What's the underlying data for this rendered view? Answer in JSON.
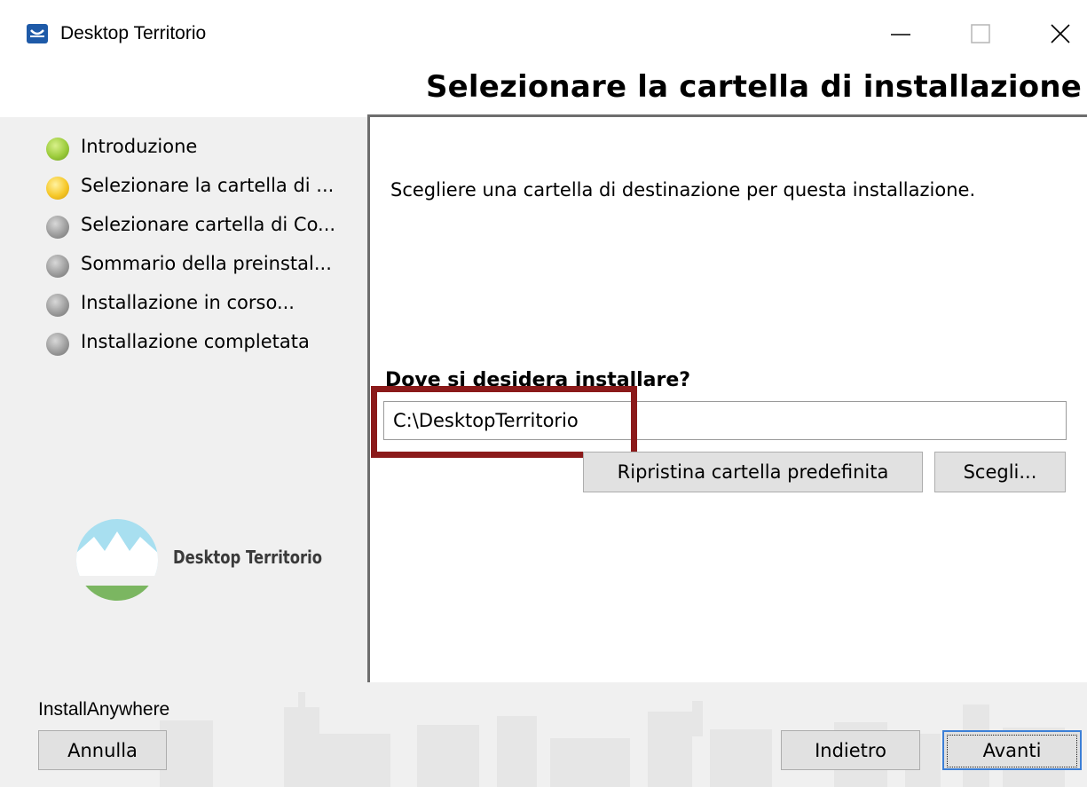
{
  "window": {
    "title": "Desktop Territorio",
    "icon": "app-logo-icon",
    "controls": [
      "minimize-icon",
      "maximize-icon",
      "close-icon"
    ]
  },
  "header": {
    "title": "Selezionare la cartella di installazione"
  },
  "steps": [
    {
      "label": "Introduzione",
      "status": "done"
    },
    {
      "label": "Selezionare la cartella di ...",
      "status": "current"
    },
    {
      "label": "Selezionare cartella di Co...",
      "status": "pending"
    },
    {
      "label": "Sommario della preinstal...",
      "status": "pending"
    },
    {
      "label": "Installazione in corso...",
      "status": "pending"
    },
    {
      "label": "Installazione completata",
      "status": "pending"
    }
  ],
  "logo": {
    "text": "Desktop Territorio"
  },
  "main": {
    "description": "Scegliere una cartella di destinazione per questa installazione.",
    "question": "Dove si desidera installare?",
    "install_path": "C:\\DesktopTerritorio",
    "restore_label": "Ripristina cartella predefinita",
    "choose_label": "Scegli..."
  },
  "footer": {
    "brand": "InstallAnywhere",
    "cancel_label": "Annulla",
    "back_label": "Indietro",
    "next_label": "Avanti"
  },
  "colors": {
    "highlight": "#8b1a1a",
    "step_done": "#9ccc3c",
    "step_current": "#f6c829",
    "step_pending": "#9d9d9d",
    "logo_sky": "#a8dff0",
    "logo_ground": "#7bb661"
  }
}
